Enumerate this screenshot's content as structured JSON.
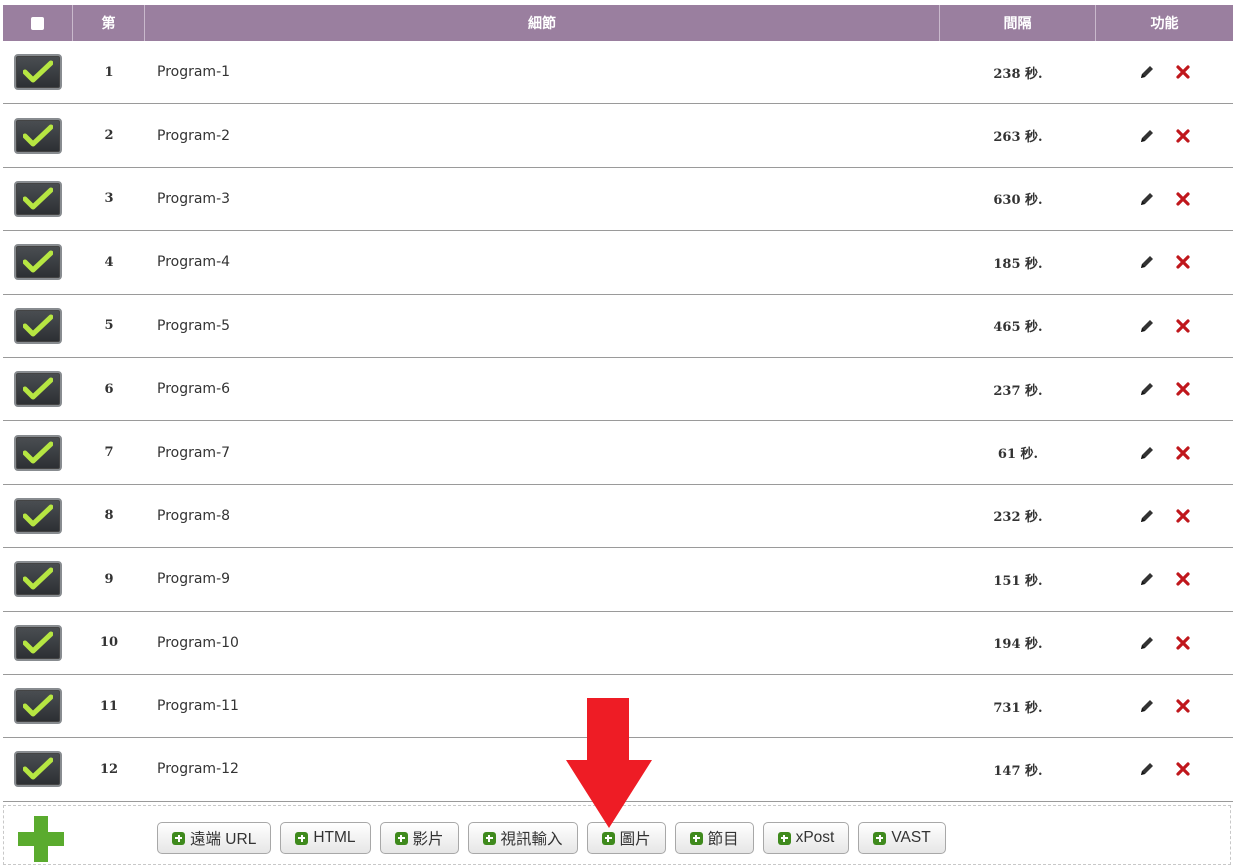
{
  "header": {
    "col_num": "第",
    "col_detail": "細節",
    "col_interval": "間隔",
    "col_function": "功能"
  },
  "rows": [
    {
      "num": "1",
      "name": "Program-1",
      "interval": "238 秒."
    },
    {
      "num": "2",
      "name": "Program-2",
      "interval": "263 秒."
    },
    {
      "num": "3",
      "name": "Program-3",
      "interval": "630 秒."
    },
    {
      "num": "4",
      "name": "Program-4",
      "interval": "185 秒."
    },
    {
      "num": "5",
      "name": "Program-5",
      "interval": "465 秒."
    },
    {
      "num": "6",
      "name": "Program-6",
      "interval": "237 秒."
    },
    {
      "num": "7",
      "name": "Program-7",
      "interval": "61 秒."
    },
    {
      "num": "8",
      "name": "Program-8",
      "interval": "232 秒."
    },
    {
      "num": "9",
      "name": "Program-9",
      "interval": "151 秒."
    },
    {
      "num": "10",
      "name": "Program-10",
      "interval": "194 秒."
    },
    {
      "num": "11",
      "name": "Program-11",
      "interval": "731 秒."
    },
    {
      "num": "12",
      "name": "Program-12",
      "interval": "147 秒."
    }
  ],
  "add_buttons": [
    {
      "label": "遠端 URL",
      "name": "add-remote-url-button"
    },
    {
      "label": "HTML",
      "name": "add-html-button"
    },
    {
      "label": "影片",
      "name": "add-video-button"
    },
    {
      "label": "視訊輸入",
      "name": "add-video-input-button"
    },
    {
      "label": "圖片",
      "name": "add-image-button"
    },
    {
      "label": "節目",
      "name": "add-program-button"
    },
    {
      "label": "xPost",
      "name": "add-xpost-button"
    },
    {
      "label": "VAST",
      "name": "add-vast-button"
    }
  ],
  "colors": {
    "header_bg": "#9a7f9f",
    "check_green": "#b6e642",
    "delete_red": "#c0171c",
    "add_green": "#5aab2e",
    "arrow_red": "#ee1c25"
  },
  "icons": {
    "checkbox": "check-icon",
    "edit": "pencil-icon",
    "delete": "close-icon",
    "add": "plus-icon"
  }
}
